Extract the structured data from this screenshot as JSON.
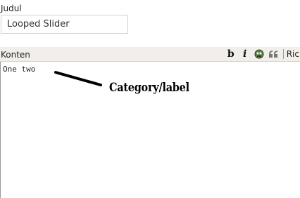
{
  "title_field": {
    "label": "Judul",
    "value": "Looped Slider"
  },
  "content_field": {
    "label": "Konten",
    "value": "One two"
  },
  "toolbar": {
    "bold_label": "b",
    "italic_label": "i",
    "image_icon": "image-icon",
    "quote_icon": "quote-icon",
    "rich_label": "Ric"
  },
  "annotation": {
    "text": "Category/label"
  }
}
